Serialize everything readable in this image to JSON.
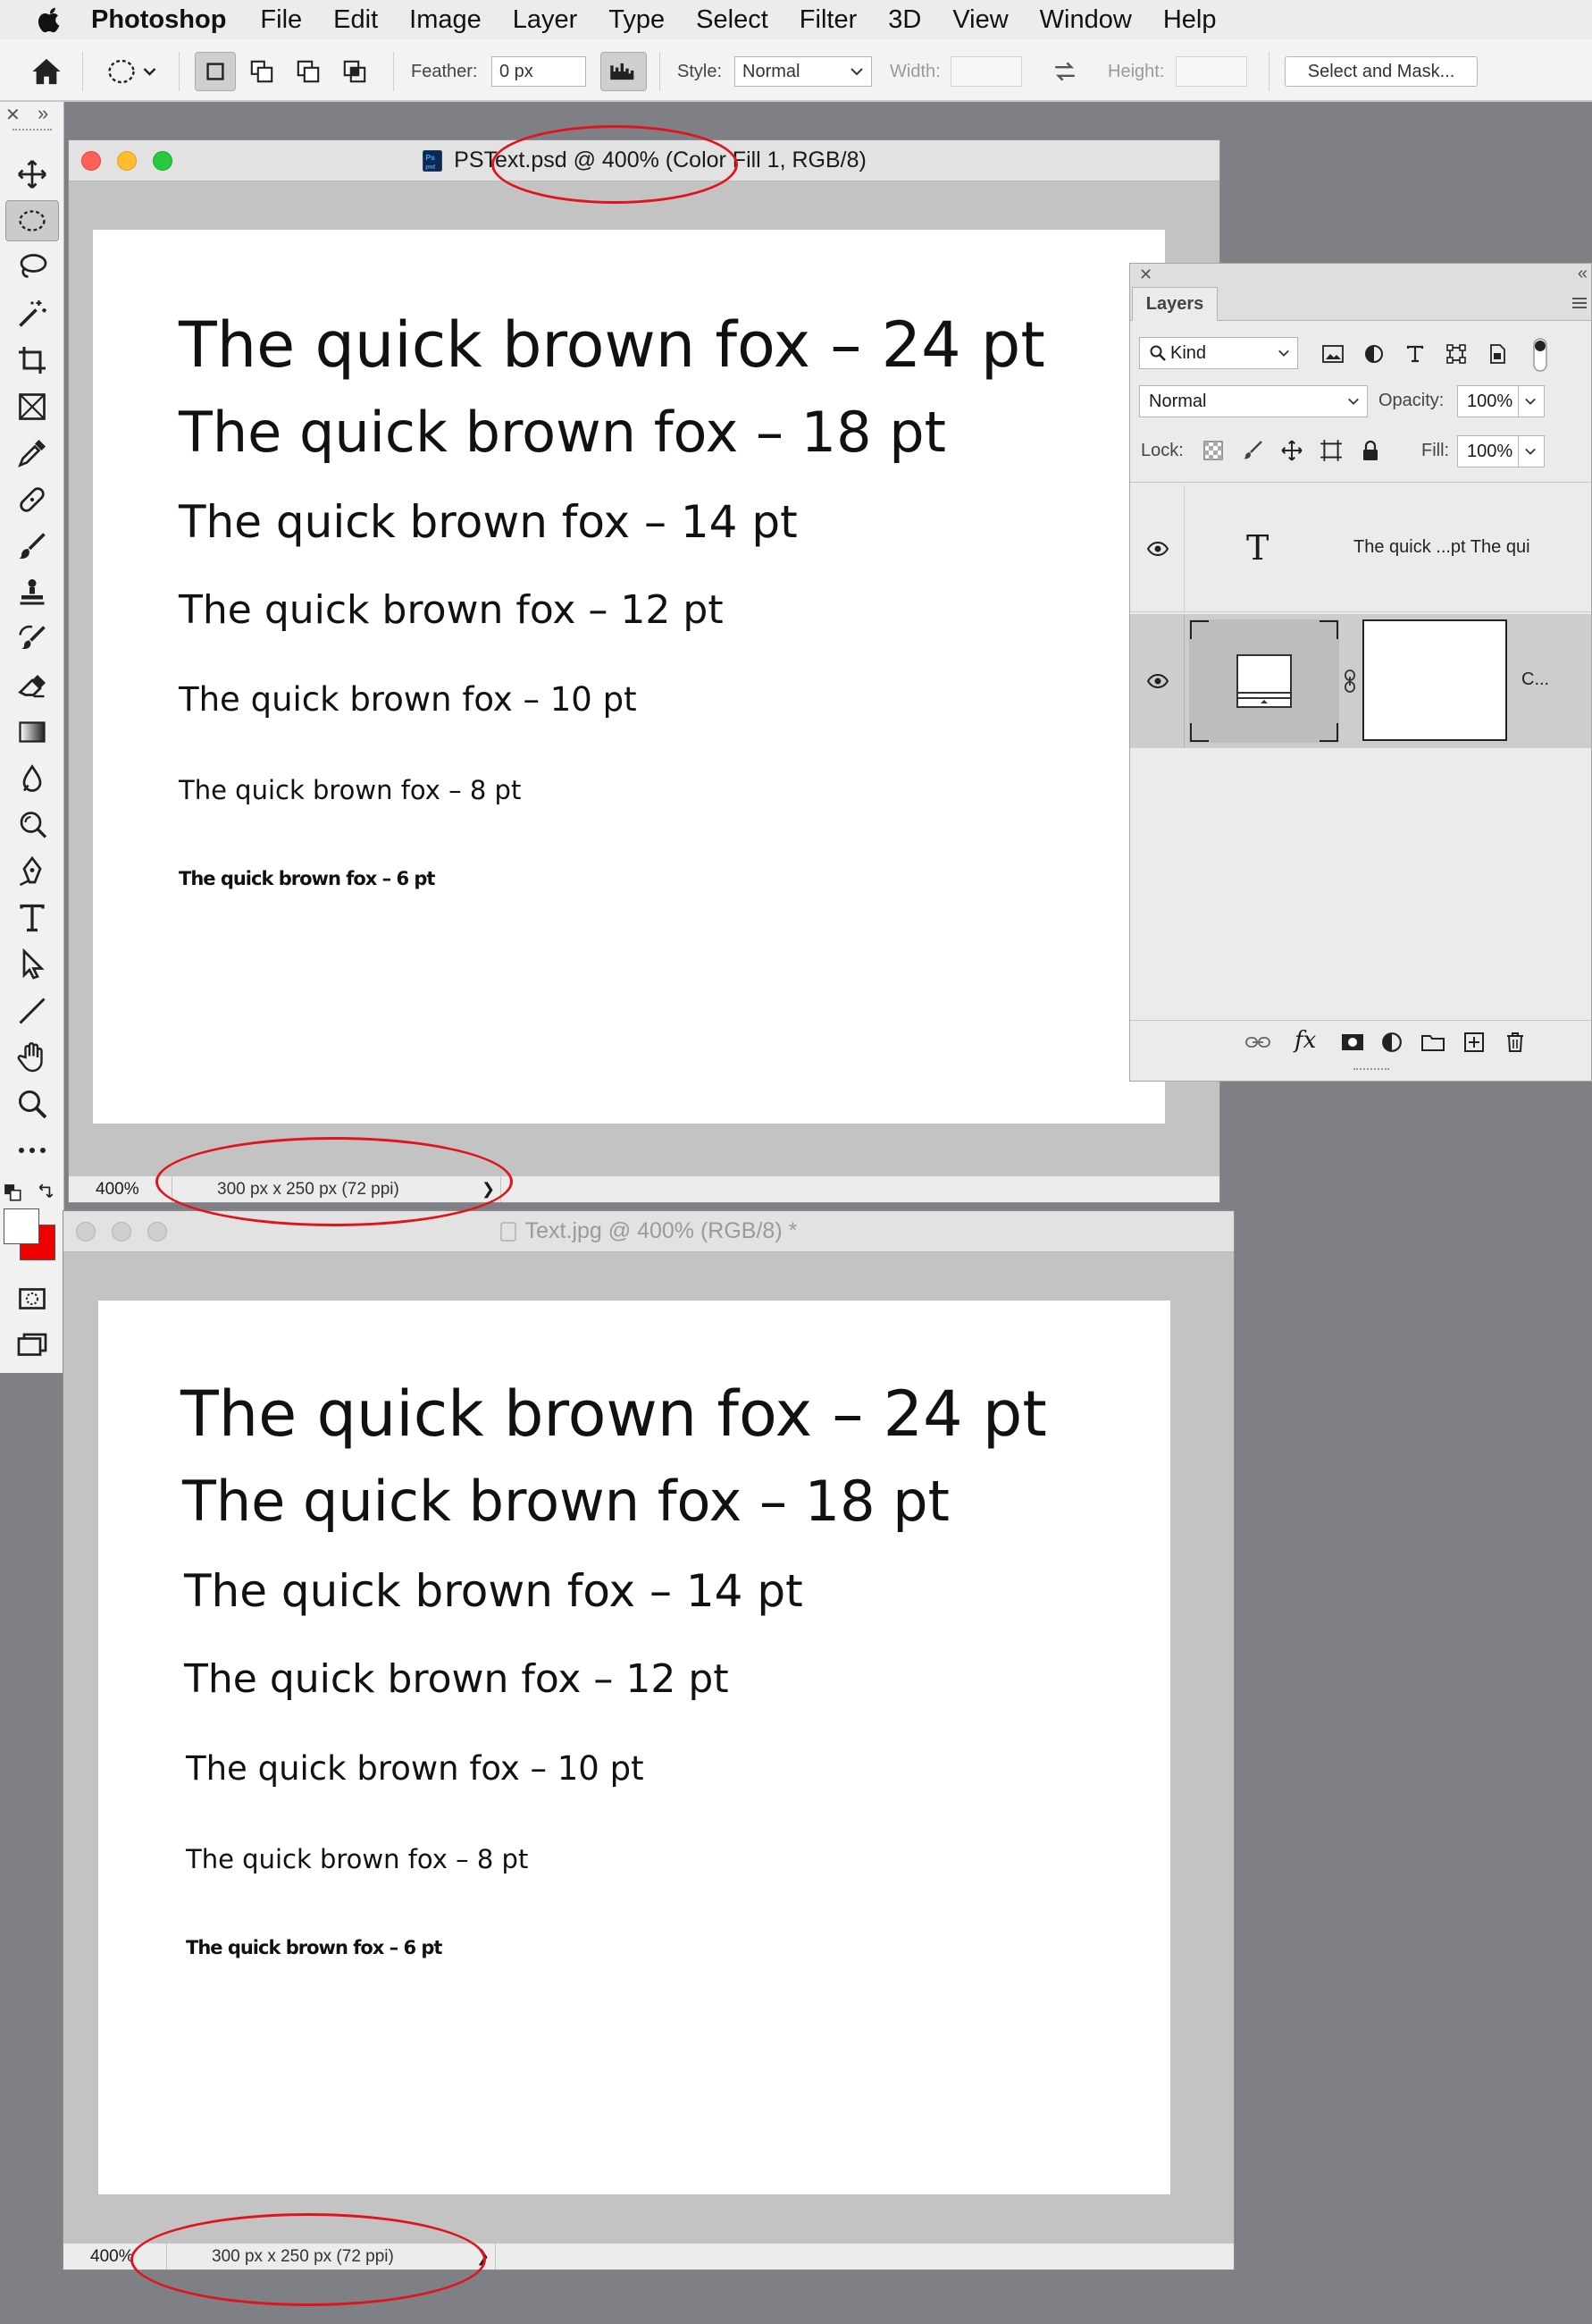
{
  "menubar": {
    "app": "Photoshop",
    "items": [
      "File",
      "Edit",
      "Image",
      "Layer",
      "Type",
      "Select",
      "Filter",
      "3D",
      "View",
      "Window",
      "Help"
    ]
  },
  "options_bar": {
    "feather_label": "Feather:",
    "feather_value": "0 px",
    "style_label": "Style:",
    "style_value": "Normal",
    "width_label": "Width:",
    "height_label": "Height:",
    "select_mask_label": "Select and Mask..."
  },
  "doc1": {
    "title": "PSText.psd @ 400% (Color Fill 1, RGB/8)",
    "zoom": "400%",
    "dims": "300 px x 250 px (72 ppi)",
    "chevron": "❯",
    "samples": [
      "The quick brown fox – 24 pt",
      "The quick brown fox – 18 pt",
      "The quick brown fox – 14 pt",
      "The quick brown fox – 12 pt",
      "The quick brown fox – 10 pt",
      "The quick brown fox – 8 pt",
      "The quick brown fox – 6 pt"
    ]
  },
  "doc2": {
    "title": "Text.jpg @ 400% (RGB/8) *",
    "zoom": "400%",
    "dims": "300 px x 250 px (72 ppi)",
    "chevron": "❯",
    "samples": [
      "The quick brown fox – 24 pt",
      "The quick brown fox – 18 pt",
      "The quick brown fox – 14 pt",
      "The quick brown fox – 12 pt",
      "The quick brown fox – 10 pt",
      "The quick brown fox – 8 pt",
      "The quick brown fox – 6 pt"
    ]
  },
  "layers_panel": {
    "tab": "Layers",
    "kind": "Kind",
    "blend_mode": "Normal",
    "opacity_label": "Opacity:",
    "opacity_value": "100%",
    "lock_label": "Lock:",
    "fill_label": "Fill:",
    "fill_value": "100%",
    "layers": [
      {
        "name": "The quick ...pt The qui",
        "type_glyph": "T"
      },
      {
        "name": "C..."
      }
    ],
    "footer_fx": "fx"
  },
  "colors": {
    "annotation": "#e0141a",
    "foreground": "#ffffff",
    "background": "#ee0000"
  }
}
